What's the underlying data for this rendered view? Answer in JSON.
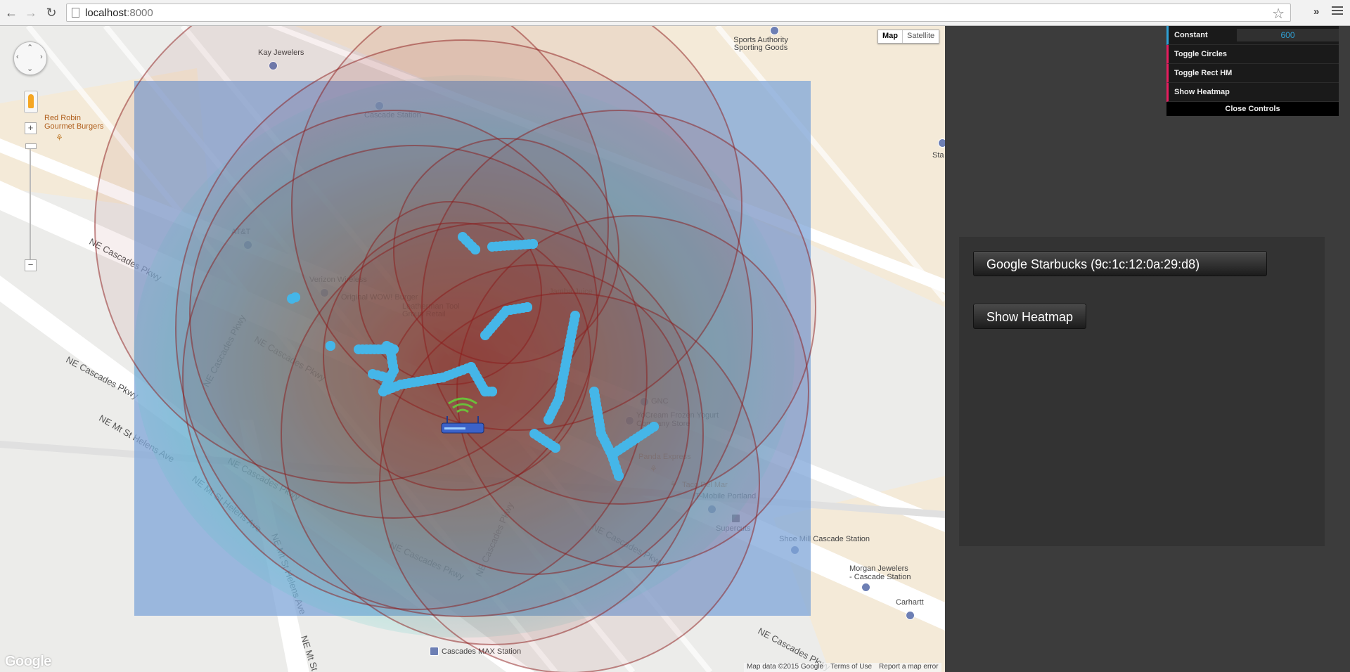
{
  "browser": {
    "url_host": "localhost",
    "url_port": ":8000"
  },
  "map": {
    "map_type_options": [
      "Map",
      "Satellite"
    ],
    "selected_map_type": "Map",
    "logo_text": "Google",
    "attribution": [
      "Map data ©2015 Google",
      "Terms of Use",
      "Report a map error"
    ],
    "overlays": {
      "rect_heatmap_color": "#7fa6d8",
      "circle_color": "#8b1a1a",
      "point_color": "#45b6e8"
    },
    "places": [
      {
        "name": "Kay Jewelers"
      },
      {
        "name": "Sports Authority Sporting Goods"
      },
      {
        "name": "Red Robin Gourmet Burgers"
      },
      {
        "name": "Cascade Station"
      },
      {
        "name": "AT&T"
      },
      {
        "name": "Verizon Wireless"
      },
      {
        "name": "Original WOW! Burger"
      },
      {
        "name": "Leatherman Tool Group Retail"
      },
      {
        "name": "Jamba Juice"
      },
      {
        "name": "GNC"
      },
      {
        "name": "YoCream Frozen Yogurt Company Store"
      },
      {
        "name": "Panda Express"
      },
      {
        "name": "Taco Del Mar"
      },
      {
        "name": "T-Mobile Portland"
      },
      {
        "name": "Supercuts"
      },
      {
        "name": "Shoe Mill Cascade Station"
      },
      {
        "name": "Morgan Jewelers - Cascade Station"
      },
      {
        "name": "Carhartt"
      },
      {
        "name": "Cascades MAX Station"
      },
      {
        "name": "Sta"
      }
    ],
    "streets": [
      "NE Cascades Pkwy",
      "NE Mt St Helens Ave",
      "NE Mt St"
    ]
  },
  "controls": {
    "constant_label": "Constant",
    "constant_value": "600",
    "toggle_circles": "Toggle Circles",
    "toggle_rect_hm": "Toggle Rect HM",
    "show_heatmap": "Show Heatmap",
    "close": "Close Controls"
  },
  "info_panel": {
    "network_button": "Google Starbucks (9c:1c:12:0a:29:d8)",
    "heatmap_button": "Show Heatmap"
  }
}
